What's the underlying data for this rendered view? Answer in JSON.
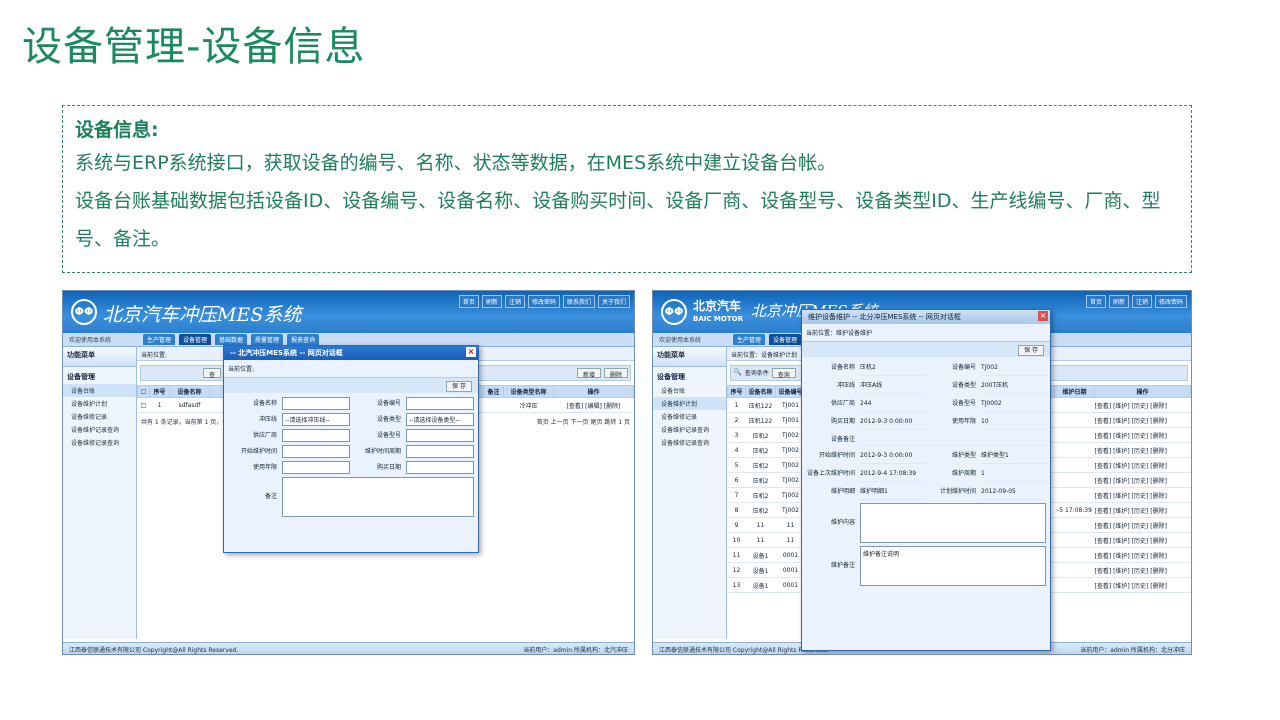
{
  "slide": {
    "title": "设备管理-设备信息",
    "heading": "设备信息:",
    "line1": "系统与ERP系统接口，获取设备的编号、名称、状态等数据，在MES系统中建立设备台帐。",
    "line2": "设备台账基础数据包括设备ID、设备编号、设备名称、设备购买时间、设备厂商、设备型号、设备类型ID、生产线编号、厂商、型号、备注。"
  },
  "shot1": {
    "app_title": "北京汽车冲压MES系统",
    "welcome": "欢迎使用本系统",
    "top_links": [
      "首页",
      "刷新",
      "注销",
      "修改密码",
      "联系我们",
      "关于我们"
    ],
    "tabs": [
      "生产管理",
      "设备管理",
      "基础数据",
      "质量管理",
      "报表查询"
    ],
    "sidebar_head": "功能菜单",
    "sidebar_group": "设备管理",
    "sidebar_items": [
      "设备台账",
      "设备维护计划",
      "设备维修记录",
      "设备维护记录查询",
      "设备维修记录查询"
    ],
    "crumb": "当前位置:",
    "toolbar": {
      "query": "查",
      "add": "新增",
      "delete": "删除"
    },
    "columns": [
      "序号",
      "设备名称",
      "备注",
      "设备类型名称",
      "操作"
    ],
    "row": {
      "no": "1",
      "name": "sdfasdf",
      "type": "冷冲压",
      "ops": "[查看] [编辑] [删除]"
    },
    "pager": "共有 1 条记录，当前第 1 页，共 1 页",
    "pager_nav": "首页 上一页 下一页 尾页  跳转 1 页",
    "footer_left": "江西泰信联通技术有限公司 Copyright@All Rights Reserved.",
    "footer_right": "当前用户：admin 所属机构：北汽冲压",
    "dialog": {
      "title": "-- 北汽冲压MES系统 -- 网页对话框",
      "crumb": "当前位置:",
      "save": "保 存",
      "fields": {
        "name": "设备名称",
        "code": "设备编号",
        "line": "冲压线",
        "line_val": "--请选择冲压线--",
        "type": "设备类型",
        "type_val": "--请选择设备类型--",
        "vendor": "供应厂商",
        "model": "设备型号",
        "start": "开始维护时间",
        "cycle": "维护时间周期",
        "years": "使用年限",
        "buy": "购买日期",
        "remark": "备注"
      }
    }
  },
  "shot2": {
    "brand": "北京汽车",
    "brand_en": "BAIC MOTOR",
    "app_title": "北京冲压MES系统",
    "tabs": [
      "生产管理",
      "设备管理",
      "基础"
    ],
    "sidebar_head": "功能菜单",
    "sidebar_group": "设备管理",
    "sidebar_items": [
      "设备台账",
      "设备维护计划",
      "设备维修记录",
      "设备维护记录查询",
      "设备维修记录查询"
    ],
    "crumb": "当前位置：设备维护计划",
    "search_label": "查询条件",
    "search_btn": "查询",
    "columns": [
      "序号",
      "设备名称",
      "设备编号",
      "维护日期",
      "操作"
    ],
    "rows": [
      {
        "no": "1",
        "name": "压机122",
        "code": "TJ001"
      },
      {
        "no": "2",
        "name": "压机122",
        "code": "TJ001"
      },
      {
        "no": "3",
        "name": "压机2",
        "code": "TJ002"
      },
      {
        "no": "4",
        "name": "压机2",
        "code": "TJ002"
      },
      {
        "no": "5",
        "name": "压机2",
        "code": "TJ002"
      },
      {
        "no": "6",
        "name": "压机2",
        "code": "TJ002"
      },
      {
        "no": "7",
        "name": "压机2",
        "code": "TJ002"
      },
      {
        "no": "8",
        "name": "压机2",
        "code": "TJ002"
      },
      {
        "no": "9",
        "name": "11",
        "code": "11"
      },
      {
        "no": "10",
        "name": "11",
        "code": "11"
      },
      {
        "no": "11",
        "name": "设备1",
        "code": "0001"
      },
      {
        "no": "12",
        "name": "设备1",
        "code": "0001"
      },
      {
        "no": "13",
        "name": "设备1",
        "code": "0001"
      }
    ],
    "ops": "[查看] [维护] [历史] [删除]",
    "date8": "-5 17:08:39",
    "footer_left": "江西泰信联通技术有限公司 Copyright@All Rights Reserved.",
    "footer_right": "当前用户：admin 所属机构：北分冲压",
    "dialog": {
      "title": "维护设备维护 -- 北分冲压MES系统 -- 网页对话框",
      "crumb": "当前位置：维护设备维护",
      "save": "保 存",
      "f": {
        "name_l": "设备名称",
        "name_v": "压机2",
        "code_l": "设备编号",
        "code_v": "TJ002",
        "line_l": "冲压线",
        "line_v": "冲压A线",
        "type_l": "设备类型",
        "type_v": "200T压机",
        "vendor_l": "供应厂商",
        "vendor_v": "244",
        "model_l": "设备型号",
        "model_v": "TJ0002",
        "buy_l": "购买日期",
        "buy_v": "2012-9-3 0:00:00",
        "years_l": "使用年限",
        "years_v": "10",
        "remark_l": "设备备注",
        "start_l": "开始维护时间",
        "start_v": "2012-9-3 0:00:00",
        "mtype_l": "维护类型",
        "mtype_v": "维护类型1",
        "last_l": "设备上次维护时间",
        "last_v": "2012-9-4 17:08:39",
        "cycle_l": "维护周期",
        "cycle_v": "1",
        "desc_l": "维护明细",
        "desc_v": "维护明细1",
        "plan_l": "计划维护时间",
        "plan_v": "2012-09-05",
        "content_l": "维护内容",
        "note_l": "维护备注",
        "note_v": "维护备注说明"
      }
    }
  }
}
